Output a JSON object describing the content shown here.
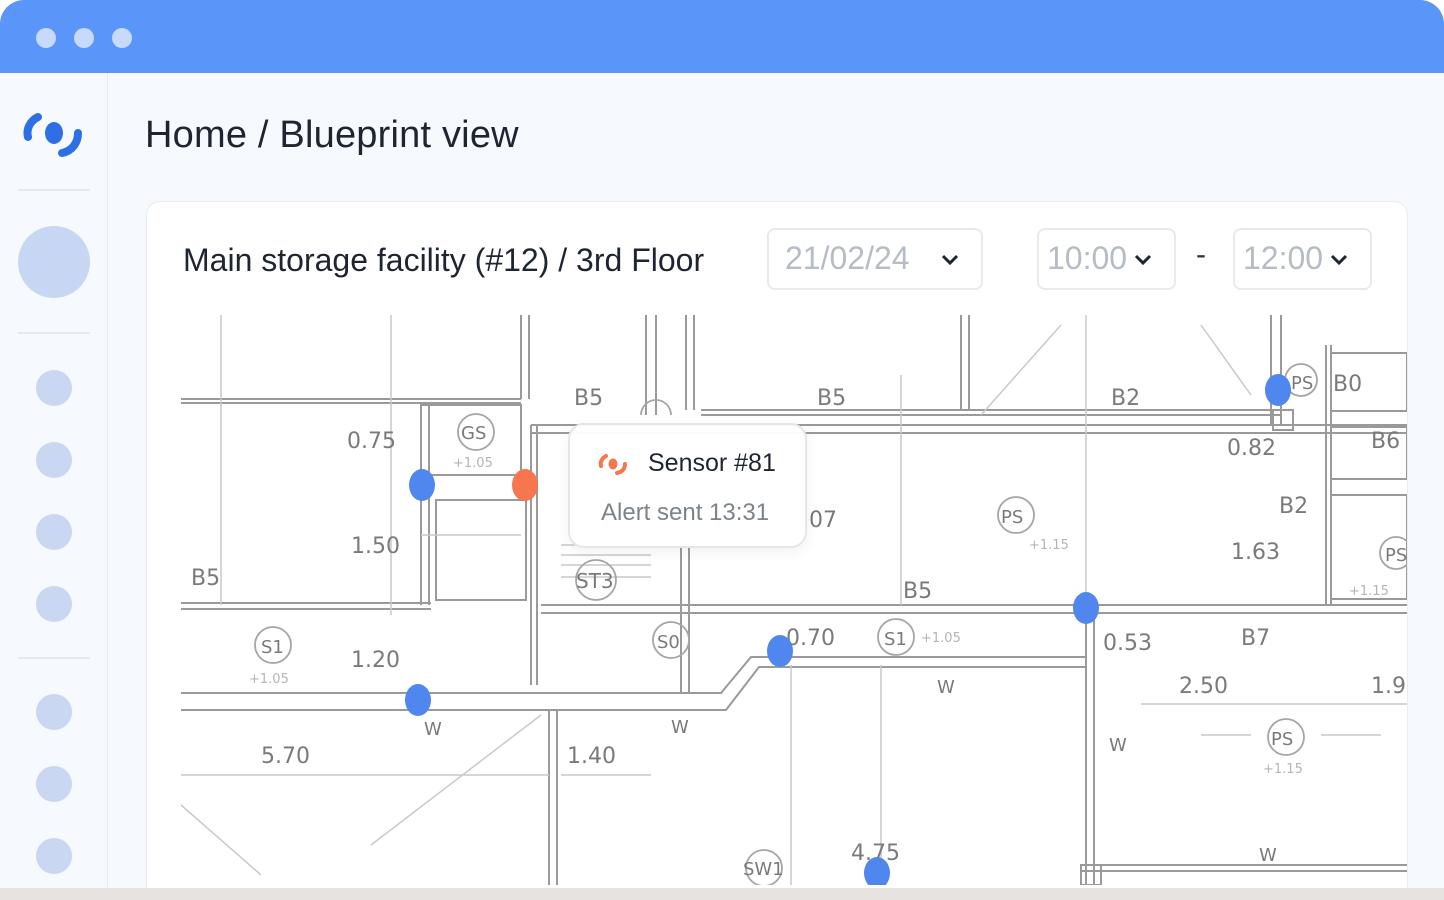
{
  "window": {
    "titlebar_color": "#5a95fa",
    "traffic_dots": [
      "window-dot-1",
      "window-dot-2",
      "window-dot-3"
    ]
  },
  "sidebar": {
    "logo_icon": "brand-logo-icon",
    "avatar": "user-avatar",
    "nav_items": [
      "nav-item-1",
      "nav-item-2",
      "nav-item-3",
      "nav-item-4",
      "nav-item-5",
      "nav-item-6",
      "nav-item-7"
    ]
  },
  "header": {
    "breadcrumb": "Home / Blueprint view"
  },
  "card": {
    "facility_title": "Main storage facility (#12) / 3rd Floor",
    "date_select": {
      "value": "21/02/24"
    },
    "time_from_select": {
      "value": "10:00"
    },
    "time_separator": "-",
    "time_to_select": {
      "value": "12:00"
    }
  },
  "blueprint": {
    "room_labels": [
      "B5",
      "B5",
      "B2",
      "B0",
      "B6",
      "B2",
      "B5",
      "B5",
      "B7"
    ],
    "dimension_labels": [
      "0.75",
      "1.50",
      "1.20",
      "5.70",
      "1.40",
      "0.70",
      "0.53",
      "2.50",
      "1.9",
      "0.82",
      "1.63",
      "07",
      "4.75"
    ],
    "symbol_labels": [
      "GS",
      "ST3",
      "S1",
      "S0",
      "S1",
      "PS",
      "PS",
      "PS",
      "PS",
      "SW1"
    ],
    "wall_labels": [
      "W",
      "W",
      "W",
      "W",
      "W"
    ],
    "elevation_labels": [
      "+1.05",
      "+1.05",
      "+1.05",
      "+1.15",
      "+1.15",
      "+1.15"
    ],
    "sensor_colors": {
      "normal": "#4f87ee",
      "alert": "#f6764f"
    }
  },
  "tooltip": {
    "icon": "alert-sensor-icon",
    "title": "Sensor #81",
    "subtitle": "Alert sent 13:31"
  }
}
